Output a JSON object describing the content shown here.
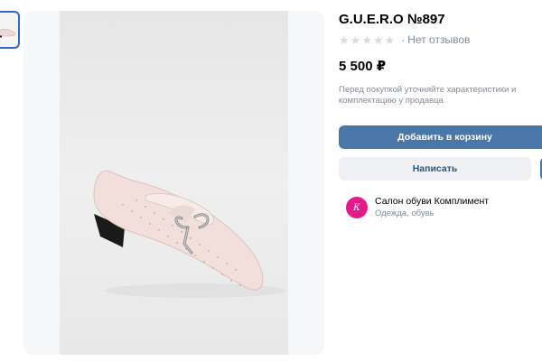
{
  "product": {
    "title": "G.U.E.R.O №897",
    "rating_text": "Нет отзывов",
    "price": "5 500 ₽",
    "note": "Перед покупкой уточняйте характеристики и комплектацию у продавца",
    "stars": 5
  },
  "actions": {
    "add_to_cart": "Добавить в корзину",
    "write": "Написать"
  },
  "shop": {
    "name": "Салон обуви Комплимент",
    "category": "Одежда, обувь",
    "avatar_glyph": "К"
  },
  "icons": {
    "star": "star-icon",
    "shop_logo": "shop-logo-icon"
  },
  "colors": {
    "primary": "#4a76a8",
    "link": "#2a5885",
    "muted": "#818c99",
    "shop_logo": "#e31b8a"
  }
}
